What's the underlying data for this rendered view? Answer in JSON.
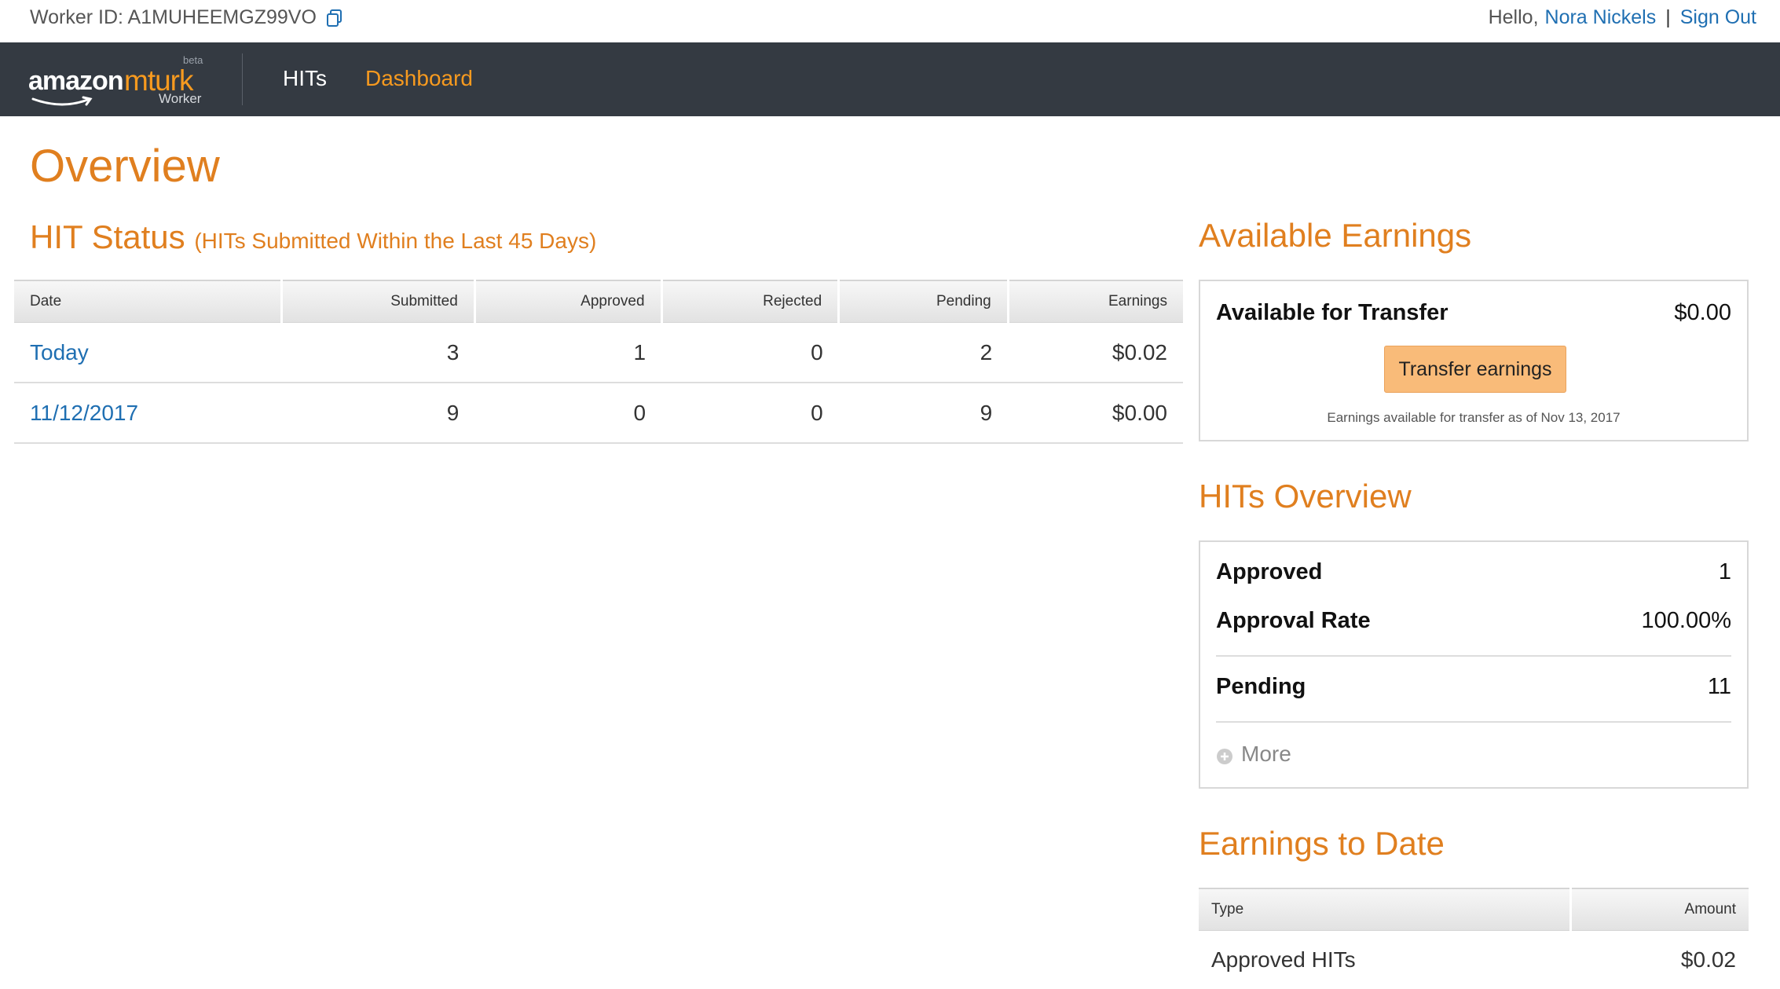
{
  "topbar": {
    "worker_id_label": "Worker ID: A1MUHEEMGZ99VO",
    "copy_icon": "copy-icon",
    "hello": "Hello,",
    "user_name": "Nora Nickels",
    "separator": "|",
    "sign_out": "Sign Out"
  },
  "nav": {
    "logo_amazon": "amazon",
    "logo_mturk": "mturk",
    "logo_beta": "beta",
    "logo_worker": "Worker",
    "hits": "HITs",
    "dashboard": "Dashboard"
  },
  "page_title": "Overview",
  "hit_status": {
    "title": "HIT Status",
    "subtitle": "(HITs Submitted Within the Last 45 Days)",
    "columns": [
      "Date",
      "Submitted",
      "Approved",
      "Rejected",
      "Pending",
      "Earnings"
    ],
    "rows": [
      [
        "Today",
        "3",
        "1",
        "0",
        "2",
        "$0.02"
      ],
      [
        "11/12/2017",
        "9",
        "0",
        "0",
        "9",
        "$0.00"
      ]
    ]
  },
  "available_earnings": {
    "title": "Available Earnings",
    "label": "Available for Transfer",
    "amount": "$0.00",
    "button": "Transfer earnings",
    "note": "Earnings available for transfer as of Nov 13, 2017"
  },
  "hits_overview": {
    "title": "HITs Overview",
    "approved_label": "Approved",
    "approved_value": "1",
    "approval_rate_label": "Approval Rate",
    "approval_rate_value": "100.00%",
    "pending_label": "Pending",
    "pending_value": "11",
    "more": "More"
  },
  "earnings_to_date": {
    "title": "Earnings to Date",
    "columns": [
      "Type",
      "Amount"
    ],
    "rows": [
      [
        "Approved HITs",
        "$0.02"
      ]
    ]
  },
  "colors": {
    "accent_orange": "#e07f1f",
    "link_blue": "#1f6fb2",
    "nav_bg": "#343a42",
    "button_bg": "#f9bb79"
  }
}
